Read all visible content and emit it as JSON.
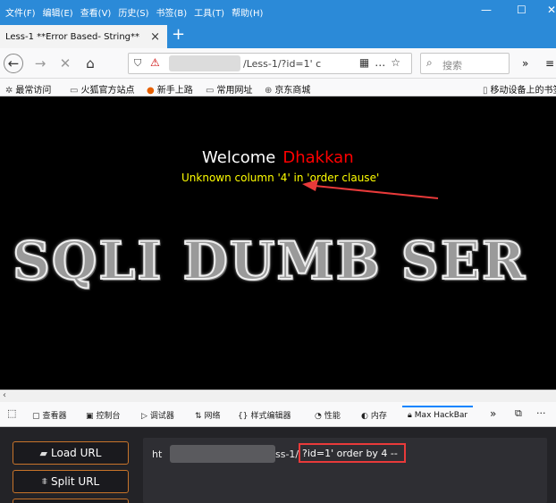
{
  "menubar": {
    "items": [
      "文件(F)",
      "编辑(E)",
      "查看(V)",
      "历史(S)",
      "书签(B)",
      "工具(T)",
      "帮助(H)"
    ]
  },
  "tab": {
    "title": "Less-1 **Error Based- String**",
    "close": "×"
  },
  "new_tab": "+",
  "urlbar": {
    "url": "/Less-1/?id=1' c"
  },
  "search": {
    "placeholder": "搜索"
  },
  "bookmarks": [
    "最常访问",
    "火狐官方站点",
    "新手上路",
    "常用网址",
    "京东商城"
  ],
  "bookmarks_right": "移动设备上的书签",
  "page": {
    "welcome": "Welcome",
    "user": "Dhakkan",
    "error": "Unknown column '4' in 'order clause'",
    "banner": "SQLI DUMB SER"
  },
  "devtools": {
    "tabs": [
      "查看器",
      "控制台",
      "调试器",
      "网络",
      "样式编辑器",
      "性能",
      "内存"
    ],
    "active": "Max HackBar",
    "more": "»"
  },
  "hackbar": {
    "load_url": "Load URL",
    "split_url": "Split URL",
    "url_prefix": "ht",
    "url_mid": "ss-1/",
    "query": "?id=1' order by  4 --"
  },
  "colors": {
    "titlebar": "#2b8ad8",
    "welcome_name": "#ff0000",
    "error_text": "#ffff00",
    "highlight_box": "#e83a3a",
    "hackbar_bg": "#232327",
    "button_border": "#c8742a"
  }
}
